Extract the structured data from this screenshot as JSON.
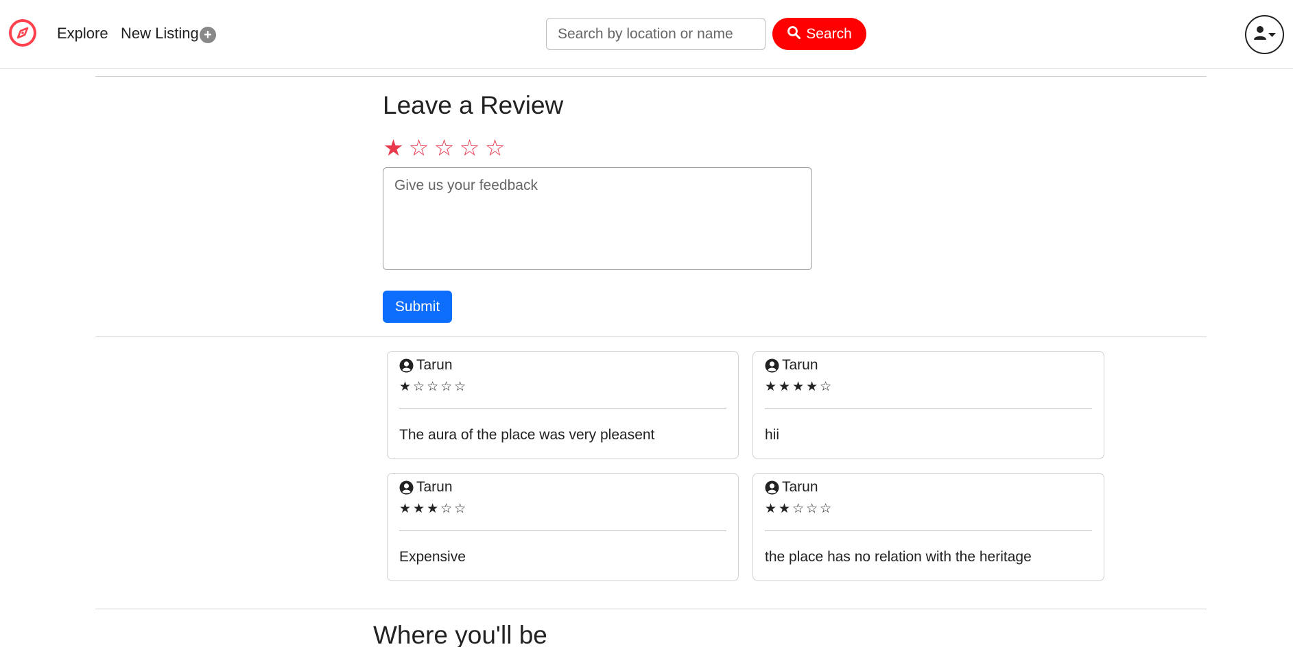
{
  "nav": {
    "explore_label": "Explore",
    "new_listing_label": "New Listing",
    "plus_glyph": "+"
  },
  "search": {
    "placeholder": "Search by location or name",
    "button_label": "Search"
  },
  "review_form": {
    "heading": "Leave a Review",
    "rating_selected": 1,
    "rating_max": 5,
    "stars": [
      "★",
      "☆",
      "☆",
      "☆",
      "☆"
    ],
    "feedback_placeholder": "Give us your feedback",
    "submit_label": "Submit"
  },
  "reviews": [
    {
      "author": "Tarun",
      "rating": 1,
      "stars_text": "★☆☆☆☆",
      "comment": "The aura of the place was very pleasent"
    },
    {
      "author": "Tarun",
      "rating": 4,
      "stars_text": "★★★★☆",
      "comment": "hii"
    },
    {
      "author": "Tarun",
      "rating": 3,
      "stars_text": "★★★☆☆",
      "comment": "Expensive"
    },
    {
      "author": "Tarun",
      "rating": 2,
      "stars_text": "★★☆☆☆",
      "comment": "the place has no relation with the heritage"
    }
  ],
  "map_section": {
    "heading": "Where you'll be"
  },
  "colors": {
    "brand": "#fe424d",
    "search_button": "#ff0000",
    "submit_button": "#0d6efd",
    "star": "#e8394d"
  },
  "icons": {
    "logo": "compass-icon",
    "search": "search-icon",
    "user": "user-circle-icon",
    "profile": "user-icon",
    "dropdown": "caret-down-icon"
  }
}
